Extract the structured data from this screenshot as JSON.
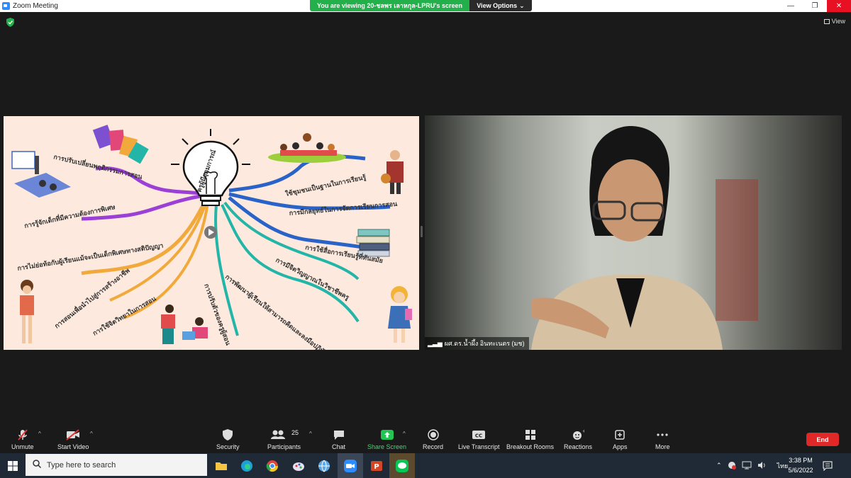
{
  "window": {
    "title": "Zoom Meeting",
    "min": "—",
    "max": "❐",
    "close": "✕"
  },
  "banner": {
    "message": "You are viewing 20-ชลพร เลาหกุล-LPRU's screen",
    "options_label": "View Options"
  },
  "meeting": {
    "view_label": "View"
  },
  "mindmap": {
    "center": "ครูผู้มีอุดมการณ์",
    "branches": [
      "การปรับเปลี่ยนพฤติกรรมการสอน",
      "การรู้จักเด็กที่มีความต้องการพิเศษ",
      "การไม่ย่อท้อกับผู้เรียนแม้จะเป็นเด็กพิเศษทางสติปัญญา",
      "การสอนเพื่อนำไปสู่การสร้างอาชีพ",
      "การใช้จิตวิทยาในการสอน",
      "การปรับตัวของครูผู้สอน",
      "ใช้ชุมชนเป็นฐานในการเรียนรู้",
      "การมีกลยุทธ์ในการจัดการเรียนการสอน",
      "การใช้สื่อการเรียนรู้ที่ทันสมัย",
      "การมีจิตวิญญาณในวิชาชีพครู",
      "การพัฒนาผู้เรียนให้สามารถคิดและลงมือปฏิบัติได้"
    ]
  },
  "participant": {
    "name": "ผศ.ดร.น้ำผึ้ง อินทะเนตร (มช)"
  },
  "toolbar": {
    "unmute": "Unmute",
    "start_video": "Start Video",
    "security": "Security",
    "participants": "Participants",
    "participants_count": "25",
    "chat": "Chat",
    "share_screen": "Share Screen",
    "record": "Record",
    "live_transcript": "Live Transcript",
    "breakout_rooms": "Breakout Rooms",
    "reactions": "Reactions",
    "apps": "Apps",
    "more": "More",
    "end": "End"
  },
  "taskbar": {
    "search_placeholder": "Type here to search",
    "language": "ไทย",
    "time": "3:38 PM",
    "date": "5/6/2022"
  },
  "colors": {
    "share_green": "#3ddb6f",
    "end_red": "#e02828",
    "banner_green": "#23b04a",
    "branch_purple": "#9b3fd6",
    "branch_orange": "#f2a93b",
    "branch_teal": "#22b5a8",
    "branch_blue": "#2a63c8"
  }
}
